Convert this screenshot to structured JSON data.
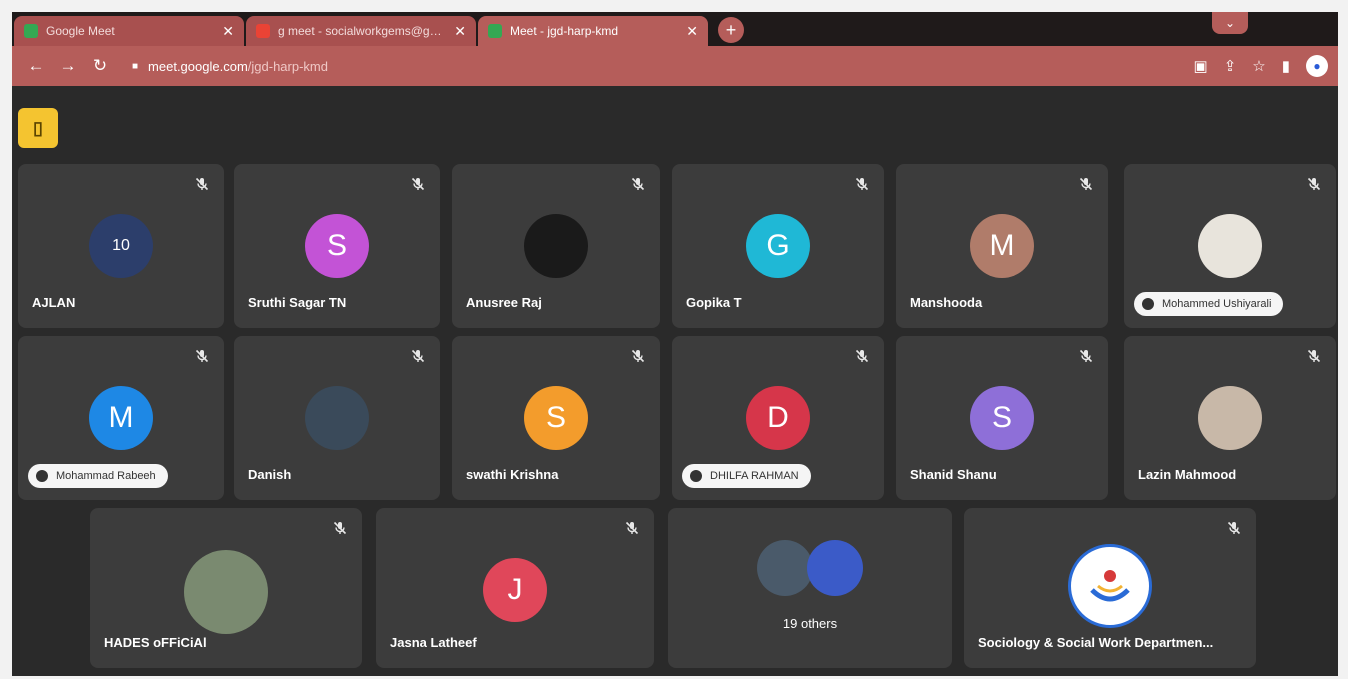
{
  "browser": {
    "tabs": [
      {
        "title": "Google Meet",
        "favicon_color": "#34a853"
      },
      {
        "title": "g meet - socialworkgems@gma...",
        "favicon_color": "#ea4335"
      },
      {
        "title": "Meet - jgd-harp-kmd",
        "favicon_color": "#34a853"
      }
    ],
    "close_glyph": "✕",
    "newtab_glyph": "+",
    "url_host": "meet.google.com",
    "url_path": "/jgd-harp-kmd"
  },
  "colors": {
    "tab_bar": "#1f1a1a",
    "accent": "#b55d5a",
    "tile": "#3c3c3c",
    "info_button": "#f4c430"
  },
  "participants": [
    {
      "name": "AJLAN",
      "avatar": "photo",
      "avatar_text": "10",
      "avatar_color": "#2c3e6b"
    },
    {
      "name": "Sruthi Sagar TN",
      "avatar": "letter",
      "avatar_text": "S",
      "avatar_color": "#c353d6"
    },
    {
      "name": "Anusree Raj",
      "avatar": "photo",
      "avatar_text": "",
      "avatar_color": "#1a1a1a"
    },
    {
      "name": "Gopika T",
      "avatar": "letter",
      "avatar_text": "G",
      "avatar_color": "#1fb8d6"
    },
    {
      "name": "Manshooda",
      "avatar": "letter",
      "avatar_text": "M",
      "avatar_color": "#b07c6a"
    },
    {
      "name": "Mohammed Ushiyarali",
      "avatar": "photo",
      "avatar_text": "",
      "avatar_color": "#e8e4dc",
      "hand_raised": true
    },
    {
      "name": "Mohammad Rabeeh",
      "avatar": "letter",
      "avatar_text": "M",
      "avatar_color": "#1e88e5",
      "hand_raised": true
    },
    {
      "name": "Danish",
      "avatar": "photo",
      "avatar_text": "",
      "avatar_color": "#3a4a5a"
    },
    {
      "name": "swathi Krishna",
      "avatar": "letter",
      "avatar_text": "S",
      "avatar_color": "#f39c2c"
    },
    {
      "name": "DHILFA RAHMAN",
      "avatar": "letter",
      "avatar_text": "D",
      "avatar_color": "#d6364a",
      "hand_raised": true
    },
    {
      "name": "Shanid Shanu",
      "avatar": "letter",
      "avatar_text": "S",
      "avatar_color": "#8e6fd8"
    },
    {
      "name": "Lazin Mahmood",
      "avatar": "photo",
      "avatar_text": "",
      "avatar_color": "#c8b8a8"
    },
    {
      "name": "HADES oFFiCiAl",
      "avatar": "photo",
      "avatar_text": "",
      "avatar_color": "#7a8a70"
    },
    {
      "name": "Jasna Latheef",
      "avatar": "letter",
      "avatar_text": "J",
      "avatar_color": "#e0475a"
    },
    {
      "name": "19 others",
      "avatar": "group",
      "avatar_text": "",
      "avatar_color": "#4a5a6a",
      "avatar_color_2": "#3b5bc8"
    },
    {
      "name": "Sociology & Social Work Departmen...",
      "avatar": "logo",
      "avatar_text": "",
      "avatar_color": "#ffffff"
    }
  ]
}
